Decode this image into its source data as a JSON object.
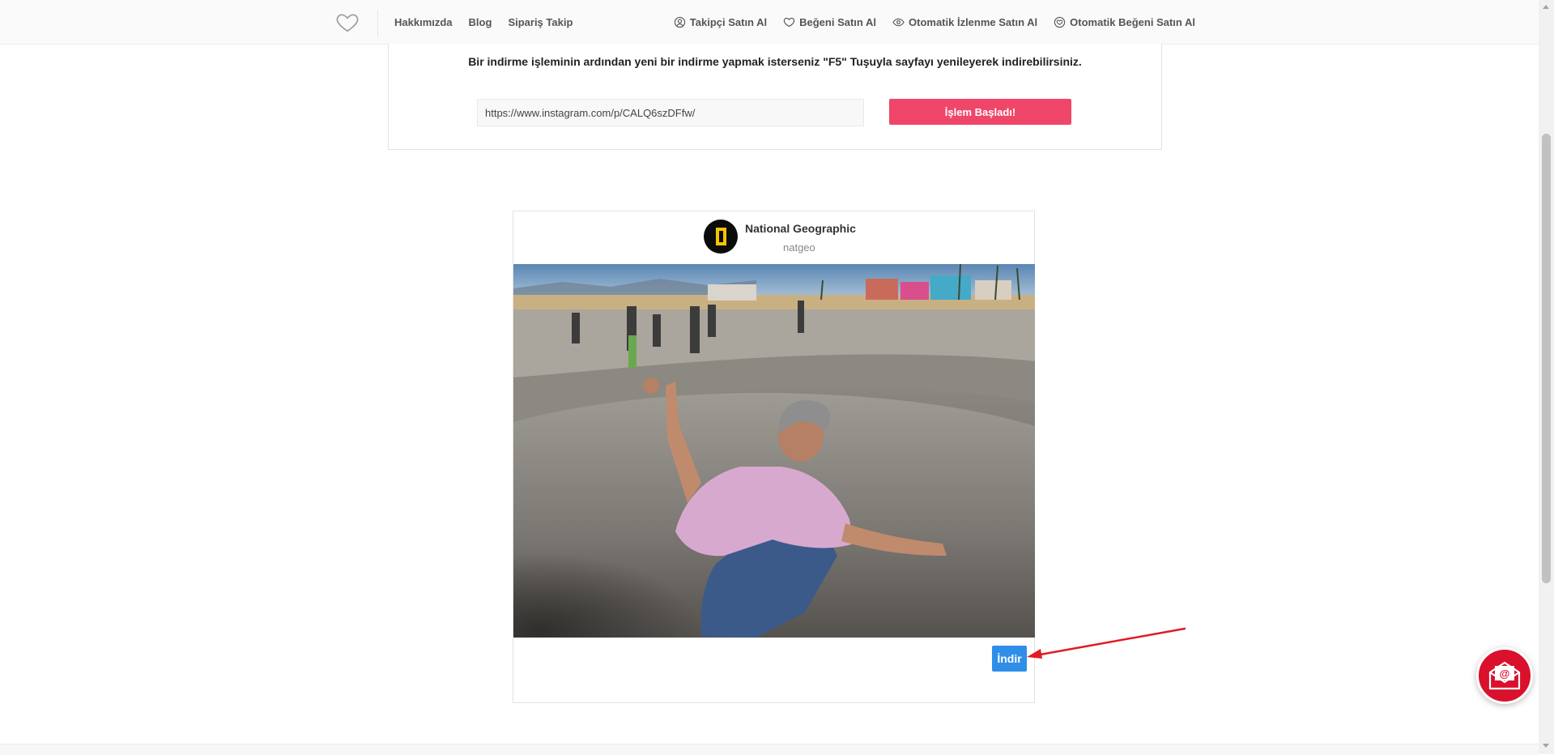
{
  "nav": {
    "left_links": [
      "Hakkımızda",
      "Blog",
      "Sipariş Takip"
    ],
    "right_links": [
      {
        "label": "Takipçi Satın Al",
        "icon": "user-circle-icon"
      },
      {
        "label": "Beğeni Satın Al",
        "icon": "heart-outline-icon"
      },
      {
        "label": "Otomatik İzlenme Satın Al",
        "icon": "eye-icon"
      },
      {
        "label": "Otomatik Beğeni Satın Al",
        "icon": "heart-circle-icon"
      }
    ]
  },
  "form": {
    "instruction": "Bir indirme işleminin ardından yeni bir indirme yapmak isterseniz \"F5\" Tuşuyla sayfayı yenileyerek indirebilirsiniz.",
    "url_value": "https://www.instagram.com/p/CALQ6szDFfw/",
    "submit_label": "İşlem Başladı!"
  },
  "post": {
    "display_name": "National Geographic",
    "username": "natgeo",
    "download_label": "İndir"
  },
  "colors": {
    "accent_pink": "#f0466a",
    "download_blue": "#2f8ee8",
    "annotation_red": "#e01b24",
    "fab_red": "#d9112d"
  }
}
